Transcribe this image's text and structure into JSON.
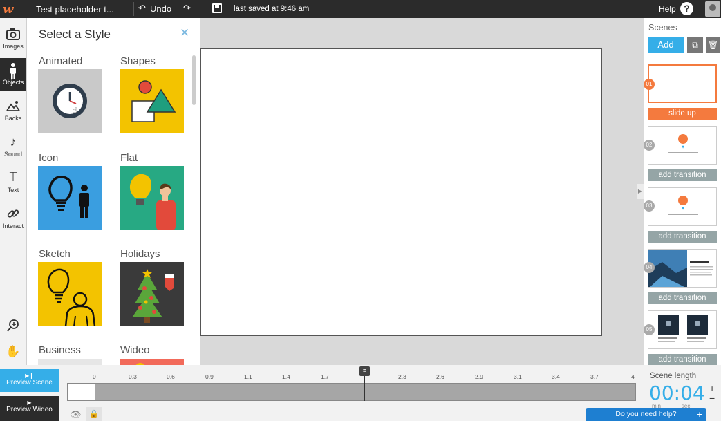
{
  "topbar": {
    "logo": "w",
    "project_title": "Test placeholder t...",
    "undo_label": "Undo",
    "saved_text": "last saved at 9:46 am",
    "help_label": "Help"
  },
  "tools": [
    {
      "label": "Images",
      "icon": "camera-icon"
    },
    {
      "label": "Objects",
      "icon": "person-icon",
      "active": true
    },
    {
      "label": "Backs",
      "icon": "landscape-icon"
    },
    {
      "label": "Sound",
      "icon": "music-note-icon"
    },
    {
      "label": "Text",
      "icon": "text-icon"
    },
    {
      "label": "Interact",
      "icon": "link-icon"
    }
  ],
  "panel": {
    "title": "Select a Style",
    "styles": [
      "Animated",
      "Shapes",
      "Icon",
      "Flat",
      "Sketch",
      "Holidays",
      "Business",
      "Wideo"
    ]
  },
  "scenes": {
    "header": "Scenes",
    "add_label": "Add",
    "items": [
      {
        "num": "01",
        "transition": "slide up"
      },
      {
        "num": "02",
        "transition": "add transition"
      },
      {
        "num": "03",
        "transition": "add transition"
      },
      {
        "num": "04",
        "transition": "add transition"
      },
      {
        "num": "05",
        "transition": "add transition"
      }
    ]
  },
  "bottom": {
    "preview_scene": "Preview Scene",
    "preview_wideo": "Preview Wideo",
    "ticks": [
      "0",
      "0.3",
      "0.6",
      "0.9",
      "1.1",
      "1.4",
      "1.7",
      "2.3",
      "2.6",
      "2.9",
      "3.1",
      "3.4",
      "3.7",
      "4"
    ],
    "scene_length_label": "Scene length",
    "scene_time": "00:04",
    "min_label": "min",
    "sec_label": "sec",
    "help_prompt": "Do you need help?"
  },
  "colors": {
    "accent": "#35aee8",
    "orange": "#f47a3e",
    "dark": "#2b2b2b"
  }
}
